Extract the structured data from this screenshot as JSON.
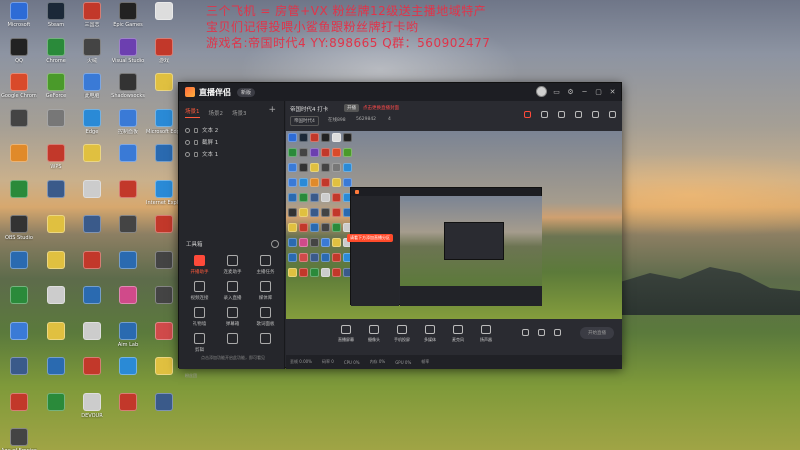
{
  "overlay": {
    "line1": "三个飞机 = 房管+VX 粉丝牌12级送主播地域特产",
    "line2": "宝贝们记得投喂小鲨鱼跟粉丝牌打卡哟",
    "line3": "游戏名:帝国时代4 YY:898665 Q群：560902477"
  },
  "desktop_icons": [
    {
      "label": "Microsoft",
      "color": "#2d6bd6"
    },
    {
      "label": "Steam",
      "color": "#1b2838"
    },
    {
      "label": "三国志",
      "color": "#c2382a"
    },
    {
      "label": "Epic Games",
      "color": "#222"
    },
    {
      "label": "",
      "color": "#ddd"
    },
    {
      "label": "QQ",
      "color": "#222"
    },
    {
      "label": "Chrome",
      "color": "#2a8a3a"
    },
    {
      "label": "火绒",
      "color": "#444"
    },
    {
      "label": "Visual Studio",
      "color": "#6c3fb0"
    },
    {
      "label": "游戏",
      "color": "#c2382a"
    },
    {
      "label": "Google Chrome",
      "color": "#d94a2a"
    },
    {
      "label": "GeForce",
      "color": "#4a9a2a"
    },
    {
      "label": "此电脑",
      "color": "#3a7ad6"
    },
    {
      "label": "Shadowsocks",
      "color": "#333"
    },
    {
      "label": "",
      "color": "#e0c040"
    },
    {
      "label": "",
      "color": "#444"
    },
    {
      "label": "",
      "color": "#777"
    },
    {
      "label": "Edge",
      "color": "#2a8ad6"
    },
    {
      "label": "控制面板",
      "color": "#3a7ad6"
    },
    {
      "label": "Microsoft Edge",
      "color": "#2a8ad6"
    },
    {
      "label": "",
      "color": "#e08a2a"
    },
    {
      "label": "WPS",
      "color": "#c2382a"
    },
    {
      "label": "",
      "color": "#e0c040"
    },
    {
      "label": "",
      "color": "#3a7ad6"
    },
    {
      "label": "",
      "color": "#2a6ab0"
    },
    {
      "label": "",
      "color": "#2a8a3a"
    },
    {
      "label": "",
      "color": "#3a5a8a"
    },
    {
      "label": "",
      "color": "#ccc"
    },
    {
      "label": "",
      "color": "#c2382a"
    },
    {
      "label": "Internet Explorer",
      "color": "#2a8ad6"
    },
    {
      "label": "OBS Studio",
      "color": "#333"
    },
    {
      "label": "",
      "color": "#e0c040"
    },
    {
      "label": "",
      "color": "#3a5a8a"
    },
    {
      "label": "",
      "color": "#444"
    },
    {
      "label": "",
      "color": "#c2382a"
    },
    {
      "label": "",
      "color": "#2a6ab0"
    },
    {
      "label": "",
      "color": "#e0c040"
    },
    {
      "label": "",
      "color": "#c2382a"
    },
    {
      "label": "",
      "color": "#2a6ab0"
    },
    {
      "label": "",
      "color": "#444"
    },
    {
      "label": "",
      "color": "#2a8a3a"
    },
    {
      "label": "",
      "color": "#ccc"
    },
    {
      "label": "",
      "color": "#2a6ab0"
    },
    {
      "label": "",
      "color": "#d04a8a"
    },
    {
      "label": "",
      "color": "#444"
    },
    {
      "label": "",
      "color": "#3a7ad6"
    },
    {
      "label": "",
      "color": "#e0c040"
    },
    {
      "label": "",
      "color": "#ccc"
    },
    {
      "label": "Aim Lab",
      "color": "#2a6ab0"
    },
    {
      "label": "",
      "color": "#d04a4a"
    },
    {
      "label": "",
      "color": "#3a5a8a"
    },
    {
      "label": "",
      "color": "#2a6ab0"
    },
    {
      "label": "",
      "color": "#c2382a"
    },
    {
      "label": "",
      "color": "#2a8ad6"
    },
    {
      "label": "",
      "color": "#e0c040"
    },
    {
      "label": "",
      "color": "#c2382a"
    },
    {
      "label": "",
      "color": "#2a8a3a"
    },
    {
      "label": "DEVOUR",
      "color": "#ccc"
    },
    {
      "label": "",
      "color": "#c2382a"
    },
    {
      "label": "",
      "color": "#3a5a8a"
    },
    {
      "label": "Age of Empires IV",
      "color": "#444"
    }
  ],
  "app": {
    "title": "直播伴侣",
    "version_badge": "新版",
    "window_buttons": [
      "▭",
      "⚙",
      "─",
      "▢",
      "✕"
    ]
  },
  "left_panel": {
    "tabs": [
      "场景1",
      "场景2",
      "场景3"
    ],
    "add_tab": "+",
    "scenes": [
      "文本 2",
      "截屏 1",
      "文本 1"
    ],
    "tools_header": "工具箱",
    "tools": [
      {
        "label": "开播助手",
        "red": true
      },
      {
        "label": "连麦助手",
        "red": false
      },
      {
        "label": "主播任务",
        "red": false
      },
      {
        "label": "视频连接",
        "red": false
      },
      {
        "label": "录入直播",
        "red": false
      },
      {
        "label": "媒体库",
        "red": false
      },
      {
        "label": "礼物墙",
        "red": false
      },
      {
        "label": "弹幕箱",
        "red": false
      },
      {
        "label": "歌词面板",
        "red": false
      },
      {
        "label": "剪辑",
        "red": false
      },
      {
        "label": "",
        "red": false
      },
      {
        "label": "",
        "red": false
      }
    ],
    "status_a": "粉丝团",
    "status_b": "点击添加功能开启此功能，即可看见"
  },
  "main": {
    "room_title": "帝国时代4 打卡",
    "room_badge": "开播",
    "room_red": "点击更换直播封面",
    "room_category": "帝国时代4",
    "room_id": "在线898",
    "room_online": "5629842",
    "room_count": "4",
    "callout": "请看下方添加直播分区"
  },
  "bottom_bar": {
    "items": [
      "直播屏幕",
      "摄像头",
      "手机投屏",
      "多媒体",
      "麦克风",
      "扬声器"
    ],
    "start_live": "开始直播"
  },
  "status_bar": {
    "items": [
      "丢帧 0.00%",
      "码率 0",
      "CPU 0%",
      "内存 0%",
      "GPU 0%",
      "帧率"
    ]
  }
}
